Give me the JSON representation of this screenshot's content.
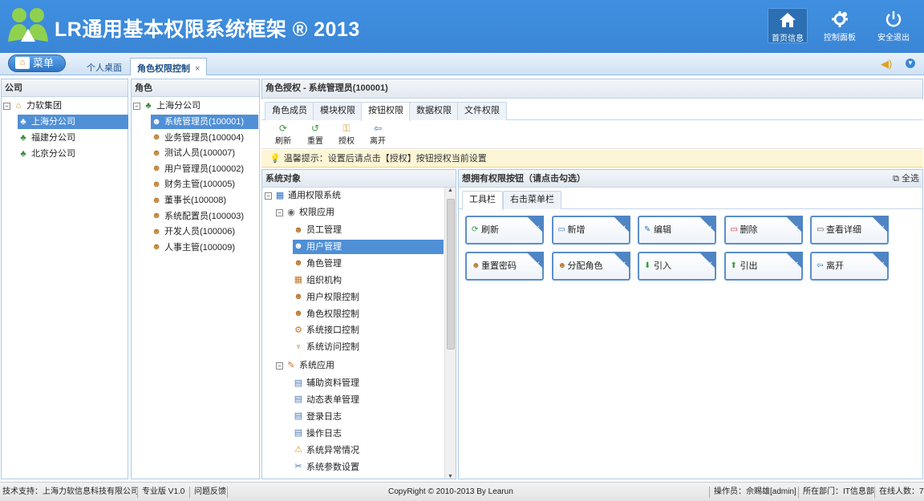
{
  "app": {
    "title": "LR通用基本权限系统框架 ® 2013"
  },
  "header_buttons": [
    {
      "label": "首页信息",
      "icon": "home-icon"
    },
    {
      "label": "控制面板",
      "icon": "gear-icon"
    },
    {
      "label": "安全退出",
      "icon": "power-icon"
    }
  ],
  "menu": {
    "label": "菜单"
  },
  "page_tabs": [
    {
      "label": "个人桌面"
    },
    {
      "label": "角色权限控制",
      "close": "×"
    }
  ],
  "company_panel": {
    "title": "公司",
    "root": {
      "label": "力软集团",
      "toggle": "−"
    },
    "children": [
      "上海分公司",
      "福建分公司",
      "北京分公司"
    ]
  },
  "role_panel": {
    "title": "角色",
    "root": {
      "label": "上海分公司",
      "toggle": "−"
    },
    "children": [
      "系统管理员(100001)",
      "业务管理员(100004)",
      "测试人员(100007)",
      "用户管理员(100002)",
      "财务主管(100005)",
      "董事长(100008)",
      "系统配置员(100003)",
      "开发人员(100006)",
      "人事主管(100009)"
    ]
  },
  "auth_panel": {
    "title": "角色授权 - 系统管理员(100001)"
  },
  "auth_tabs": [
    "角色成员",
    "模块权限",
    "按钮权限",
    "数据权限",
    "文件权限"
  ],
  "toolbar": [
    {
      "label": "刷新",
      "icon": "refresh-icon"
    },
    {
      "label": "重置",
      "icon": "reset-icon"
    },
    {
      "label": "授权",
      "icon": "key-icon"
    },
    {
      "label": "离开",
      "icon": "exit-icon"
    }
  ],
  "tip": {
    "text": "温馨提示：设置后请点击【授权】按钮授权当前设置"
  },
  "system_tree": {
    "title": "系统对象",
    "root": "通用权限系统",
    "group1": {
      "label": "权限应用",
      "toggle": "−"
    },
    "group1_items": [
      "员工管理",
      "用户管理",
      "角色管理",
      "组织机构",
      "用户权限控制",
      "角色权限控制",
      "系统接口控制",
      "系统访问控制"
    ],
    "group2": {
      "label": "系统应用",
      "toggle": "−"
    },
    "group2_items": [
      "辅助资料管理",
      "动态表单管理",
      "登录日志",
      "操作日志",
      "系统异常情况",
      "系统参数设置"
    ]
  },
  "button_panel": {
    "title": "想拥有权限按钮（请点击勾选）",
    "select_all": "全选",
    "tabs": [
      "工具栏",
      "右击菜单栏"
    ],
    "buttons": [
      "刷新",
      "新增",
      "编辑",
      "删除",
      "查看详细",
      "重置密码",
      "分配角色",
      "引入",
      "引出",
      "离开"
    ]
  },
  "footer": {
    "support": "技术支持：上海力软信息科技有限公司",
    "edition": "专业版 V1.0",
    "feedback": "问题反馈",
    "copyright": "CopyRight © 2010-2013 By Learun",
    "operator": "操作员：佘赐雄[admin]",
    "dept": "所在部门：IT信息部",
    "online": "在线人数：7"
  },
  "colors": {
    "header": "#3f8fe0",
    "selected": "#4f8fd6",
    "tip_bg": "#fdf6d6",
    "button_border": "#5b8fc9"
  }
}
